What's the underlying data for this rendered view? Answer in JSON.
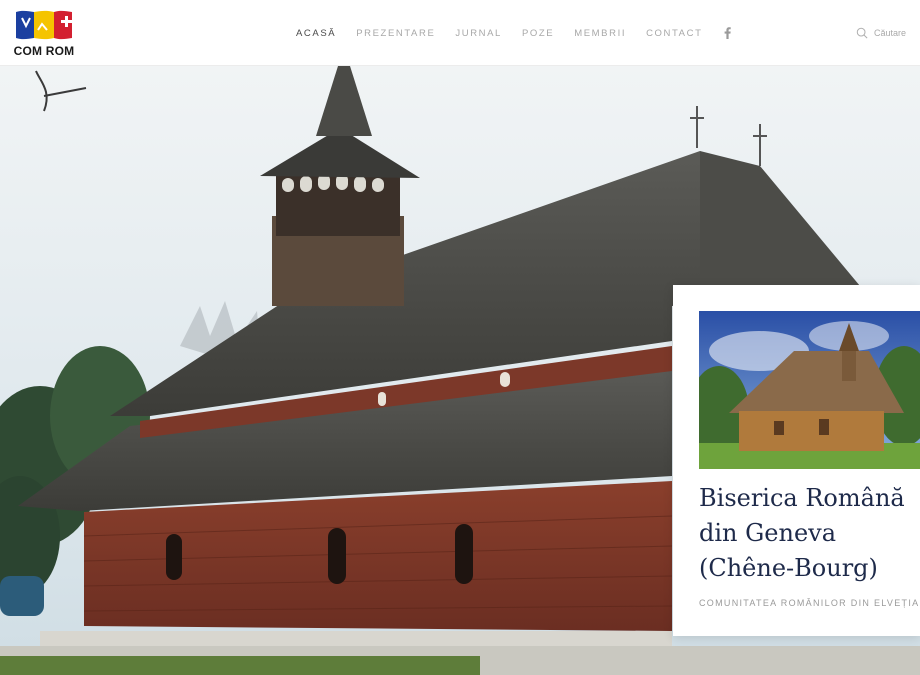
{
  "logo": {
    "text": "COM ROM",
    "flag_colors": [
      "#1b3fa0",
      "#f5c400",
      "#d32030"
    ]
  },
  "nav": {
    "items": [
      {
        "label": "ACASĂ",
        "active": true
      },
      {
        "label": "PREZENTARE",
        "active": false
      },
      {
        "label": "JURNAL",
        "active": false
      },
      {
        "label": "POZE",
        "active": false
      },
      {
        "label": "MEMBRII",
        "active": false
      },
      {
        "label": "CONTACT",
        "active": false
      }
    ],
    "social_icon": "facebook-icon"
  },
  "search": {
    "placeholder": "Căutare",
    "icon": "search-icon"
  },
  "card": {
    "title_lines": [
      "Biserica Română",
      "din Geneva",
      "(Chêne-Bourg)"
    ],
    "subtitle": "COMUNITATEA ROMÂNILOR DIN ELVEȚIA"
  },
  "colors": {
    "title": "#1e2a4a",
    "nav_active": "#4a4a4a",
    "nav_inactive": "#a8a8a8"
  }
}
